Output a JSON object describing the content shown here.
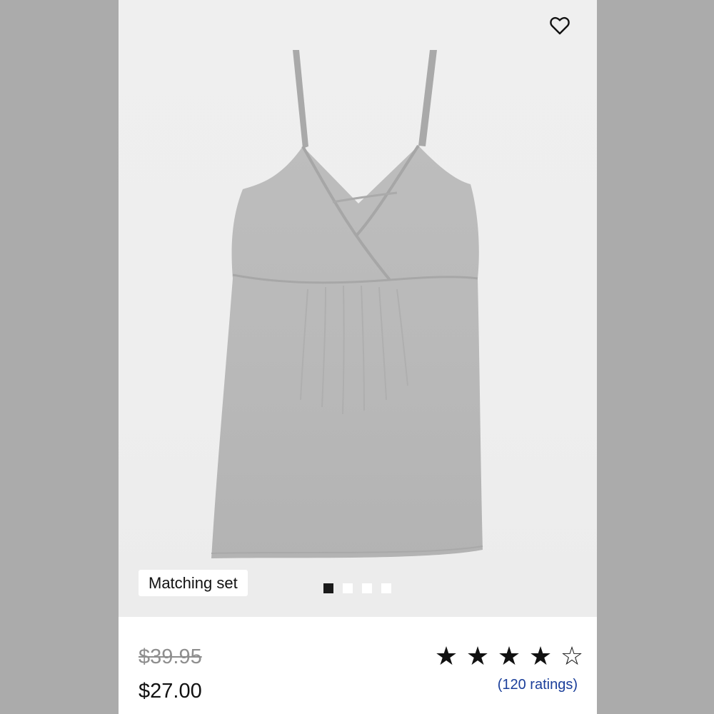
{
  "product": {
    "badge_label": "Matching set",
    "original_price": "$39.95",
    "sale_price": "$27.00",
    "rating_text": "(120 ratings)",
    "rating": {
      "value": 4,
      "max": 5
    },
    "image_dots": {
      "count": 4,
      "active_index": 0
    }
  },
  "icons": {
    "favorite": "heart-outline-icon",
    "star_filled": "★",
    "star_empty": "☆"
  },
  "colors": {
    "background_side": "#ababab",
    "image_background": "#eeeeee",
    "garment": "#b8b8b8",
    "rating_link": "#1a3e9a",
    "old_price": "#8e8e8e"
  }
}
